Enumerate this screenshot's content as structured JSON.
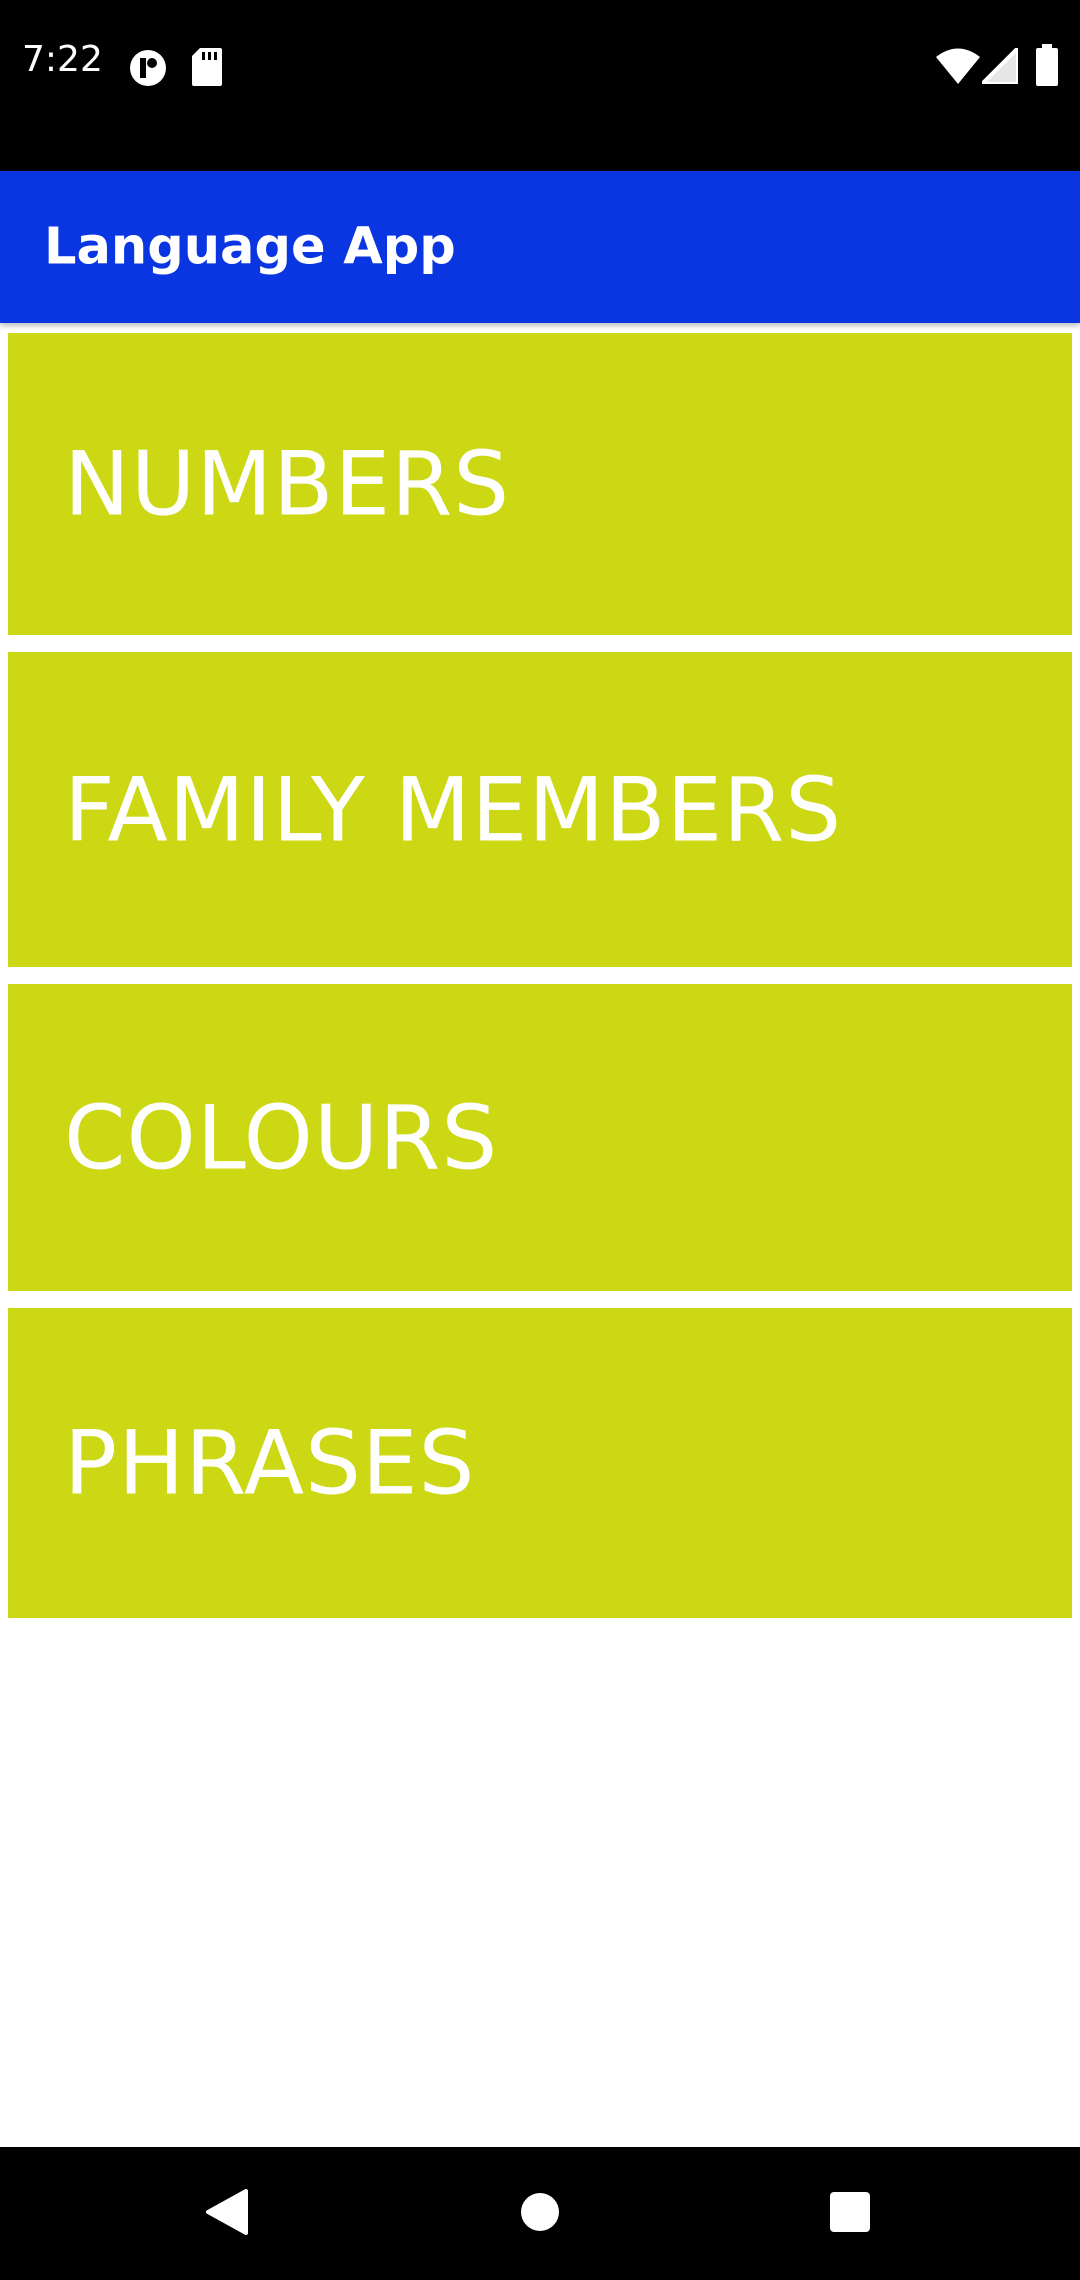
{
  "status_bar": {
    "time": "7:22",
    "icons_left": [
      "privacy-dot-icon",
      "sd-card-icon"
    ],
    "icons_right": [
      "wifi-icon",
      "cell-signal-icon",
      "battery-icon"
    ]
  },
  "app_bar": {
    "title": "Language App",
    "color": "#0a36e2"
  },
  "categories": [
    {
      "label": "NUMBERS"
    },
    {
      "label": "FAMILY MEMBERS"
    },
    {
      "label": "COLOURS"
    },
    {
      "label": "PHRASES"
    }
  ],
  "category_color": "#cdd815",
  "nav_bar": {
    "buttons": [
      "back-icon",
      "home-icon",
      "recents-icon"
    ]
  }
}
